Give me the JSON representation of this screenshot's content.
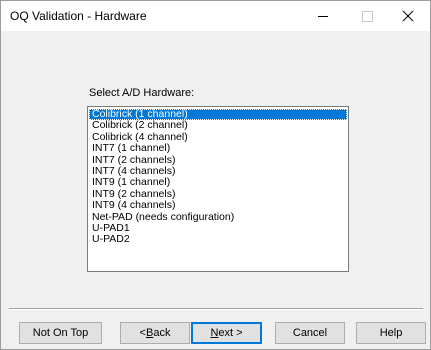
{
  "window": {
    "title": "OQ Validation - Hardware"
  },
  "titlebar": {
    "minimize_icon": "minimize-icon",
    "maximize_icon": "maximize-icon",
    "close_icon": "close-icon"
  },
  "main": {
    "label": "Select A/D Hardware:",
    "hardware_list": [
      "Colibrick (1 channel)",
      "Colibrick (2 channel)",
      "Colibrick (4 channel)",
      "INT7 (1 channel)",
      "INT7 (2 channels)",
      "INT7 (4 channels)",
      "INT9 (1 channel)",
      "INT9 (2 channels)",
      "INT9 (4 channels)",
      "Net-PAD (needs configuration)",
      "U-PAD1",
      "U-PAD2"
    ],
    "selected": "Colibrick (1 channel)"
  },
  "buttons": {
    "not_on_top": "Not On Top",
    "back": "< Back",
    "next": "Next >",
    "cancel": "Cancel",
    "help": "Help"
  },
  "colors": {
    "selection": "#0078d7",
    "dialog_bg": "#f0f0f0"
  }
}
